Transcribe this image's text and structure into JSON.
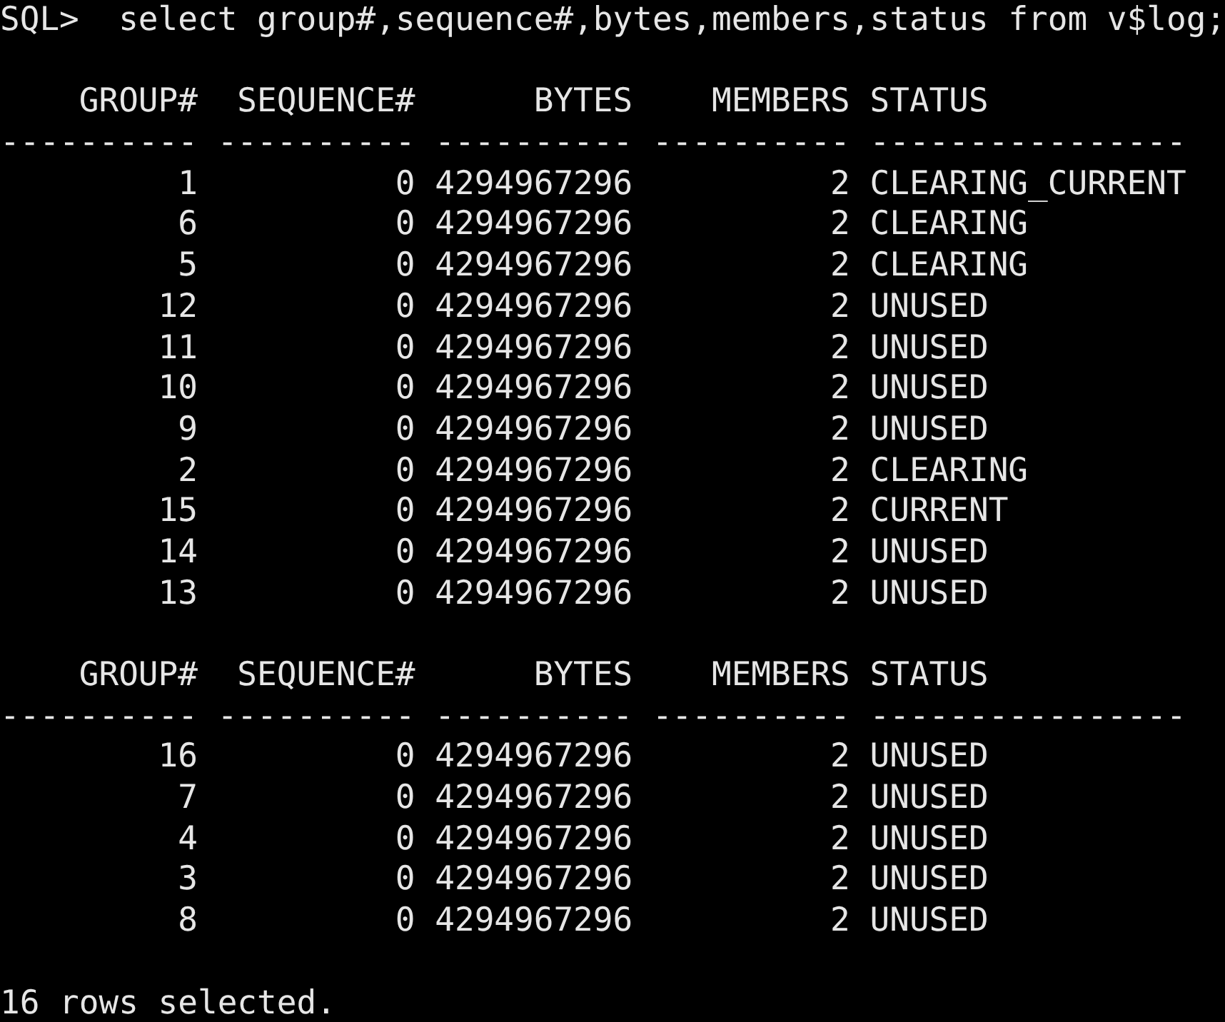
{
  "prompt": "SQL>",
  "command": "select group#,sequence#,bytes,members,status from v$log;",
  "tables": [
    {
      "columns": [
        "GROUP#",
        "SEQUENCE#",
        "BYTES",
        "MEMBERS",
        "STATUS"
      ],
      "separators": [
        "----------",
        "----------",
        "----------",
        "----------",
        "----------------"
      ],
      "rows": [
        [
          "1",
          "0",
          "4294967296",
          "2",
          "CLEARING_CURRENT"
        ],
        [
          "6",
          "0",
          "4294967296",
          "2",
          "CLEARING"
        ],
        [
          "5",
          "0",
          "4294967296",
          "2",
          "CLEARING"
        ],
        [
          "12",
          "0",
          "4294967296",
          "2",
          "UNUSED"
        ],
        [
          "11",
          "0",
          "4294967296",
          "2",
          "UNUSED"
        ],
        [
          "10",
          "0",
          "4294967296",
          "2",
          "UNUSED"
        ],
        [
          "9",
          "0",
          "4294967296",
          "2",
          "UNUSED"
        ],
        [
          "2",
          "0",
          "4294967296",
          "2",
          "CLEARING"
        ],
        [
          "15",
          "0",
          "4294967296",
          "2",
          "CURRENT"
        ],
        [
          "14",
          "0",
          "4294967296",
          "2",
          "UNUSED"
        ],
        [
          "13",
          "0",
          "4294967296",
          "2",
          "UNUSED"
        ]
      ]
    },
    {
      "columns": [
        "GROUP#",
        "SEQUENCE#",
        "BYTES",
        "MEMBERS",
        "STATUS"
      ],
      "separators": [
        "----------",
        "----------",
        "----------",
        "----------",
        "----------------"
      ],
      "rows": [
        [
          "16",
          "0",
          "4294967296",
          "2",
          "UNUSED"
        ],
        [
          "7",
          "0",
          "4294967296",
          "2",
          "UNUSED"
        ],
        [
          "4",
          "0",
          "4294967296",
          "2",
          "UNUSED"
        ],
        [
          "3",
          "0",
          "4294967296",
          "2",
          "UNUSED"
        ],
        [
          "8",
          "0",
          "4294967296",
          "2",
          "UNUSED"
        ]
      ]
    }
  ],
  "footer": "16 rows selected."
}
